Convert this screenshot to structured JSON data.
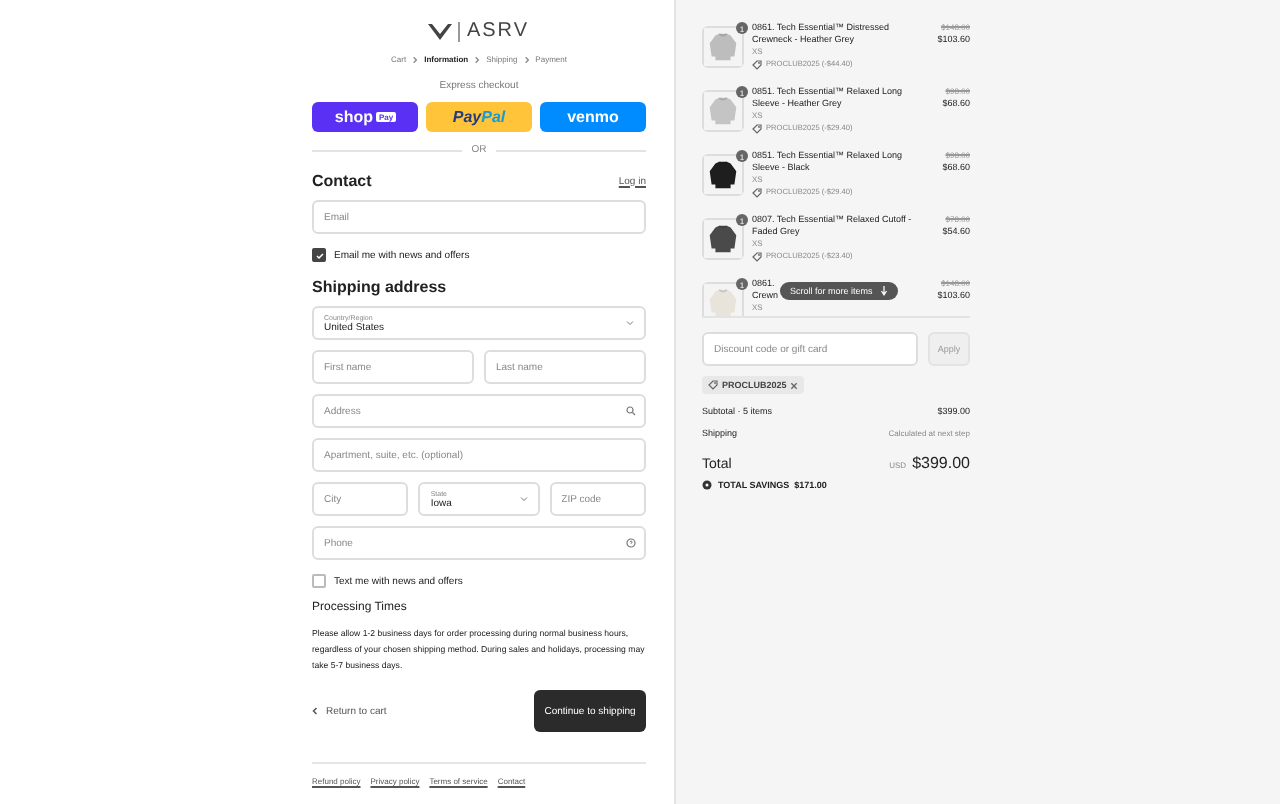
{
  "brand": "ASRV",
  "breadcrumbs": [
    {
      "label": "Cart",
      "selected": false
    },
    {
      "label": "Information",
      "selected": true
    },
    {
      "label": "Shipping",
      "selected": false
    },
    {
      "label": "Payment",
      "selected": false
    }
  ],
  "express": {
    "title": "Express checkout",
    "buttons": [
      {
        "kind": "shop",
        "label": "shop",
        "badge": "Pay"
      },
      {
        "kind": "paypal",
        "label": "Pay",
        "label2": "Pal"
      },
      {
        "kind": "venmo",
        "label": "venmo"
      }
    ],
    "divider": "OR"
  },
  "contact": {
    "title": "Contact",
    "login": "Log in",
    "email": {
      "placeholder": "Email"
    },
    "newsletter": {
      "label": "Email me with news and offers",
      "checked": true
    }
  },
  "shipping": {
    "title": "Shipping address",
    "country": {
      "label": "Country/Region",
      "value": "United States"
    },
    "first_name": {
      "placeholder": "First name"
    },
    "last_name": {
      "placeholder": "Last name"
    },
    "address": {
      "placeholder": "Address"
    },
    "apartment": {
      "placeholder": "Apartment, suite, etc. (optional)"
    },
    "city": {
      "placeholder": "City"
    },
    "state": {
      "label": "State",
      "value": "Iowa"
    },
    "zip": {
      "placeholder": "ZIP code"
    },
    "phone": {
      "placeholder": "Phone"
    },
    "sms": {
      "label": "Text me with news and offers",
      "checked": false
    }
  },
  "processing": {
    "title": "Processing Times",
    "text": "Please allow 1-2 business days for order processing during normal business hours, regardless of your chosen shipping method. During sales and holidays, processing may take 5-7 business days."
  },
  "actions": {
    "back": "Return to cart",
    "continue": "Continue to shipping"
  },
  "footer_links": [
    "Refund policy",
    "Privacy policy",
    "Terms of service",
    "Contact"
  ],
  "cart": {
    "items": [
      {
        "qty": "1",
        "lines": [
          "0861. Tech Essential™ Distressed",
          "Crewneck - Heather Grey"
        ],
        "variant": "XS",
        "discount": "PROCLUB2025 (-$44.40)",
        "old_price": "$148.00",
        "price": "$103.60"
      },
      {
        "qty": "1",
        "lines": [
          "0851. Tech Essential™ Relaxed Long",
          "Sleeve - Heather Grey"
        ],
        "variant": "XS",
        "discount": "PROCLUB2025 (-$29.40)",
        "old_price": "$98.00",
        "price": "$68.60"
      },
      {
        "qty": "1",
        "lines": [
          "0851. Tech Essential™ Relaxed Long",
          "Sleeve - Black"
        ],
        "variant": "XS",
        "discount": "PROCLUB2025 (-$29.40)",
        "old_price": "$98.00",
        "price": "$68.60"
      },
      {
        "qty": "1",
        "lines": [
          "0807. Tech Essential™ Relaxed Cutoff -",
          "Faded Grey"
        ],
        "variant": "XS",
        "discount": "PROCLUB2025 (-$23.40)",
        "old_price": "$78.00",
        "price": "$54.60"
      },
      {
        "qty": "1",
        "lines": [
          "0861.",
          "Crewn"
        ],
        "variant": "XS",
        "old_price": "$148.00",
        "price": "$103.60"
      }
    ],
    "scroll_hint": "Scroll for more items",
    "discount_field": {
      "placeholder": "Discount code or gift card"
    },
    "apply": "Apply",
    "applied_code": "PROCLUB2025",
    "subtotal": {
      "label": "Subtotal · 5 items",
      "value": "$399.00"
    },
    "shipping": {
      "label": "Shipping",
      "value": "Calculated at next step"
    },
    "total": {
      "label": "Total",
      "currency": "USD",
      "value": "$399.00"
    },
    "savings": "TOTAL SAVINGS  $171.00"
  }
}
